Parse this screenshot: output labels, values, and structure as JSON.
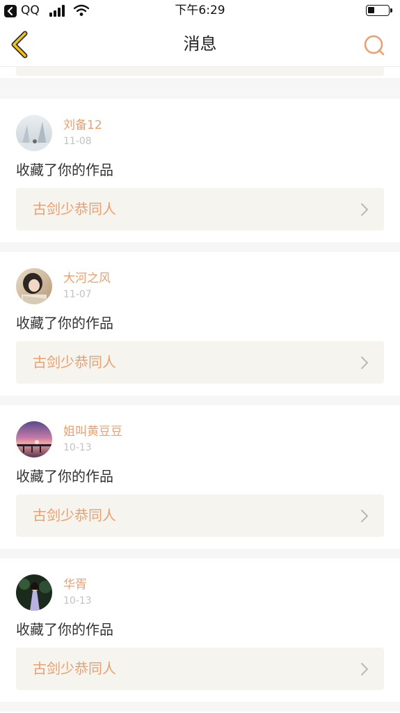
{
  "status_bar": {
    "back_app": "QQ",
    "time": "下午6:29",
    "battery_level": 0.35
  },
  "nav": {
    "title": "消息",
    "back_icon": "chevron-left-icon",
    "search_icon": "search-icon"
  },
  "colors": {
    "accent": "#ec9f6e",
    "back_arrow": "#e6b800",
    "work_box_bg": "#f5f4ee",
    "date": "#c2c2c2",
    "text": "#333333",
    "separator": "#f6f6f6"
  },
  "partial_card": {
    "note": ""
  },
  "messages": [
    {
      "username": "刘备12",
      "date": "11-08",
      "action": "收藏了你的作品",
      "work_title": "古剑少恭同人"
    },
    {
      "username": "大河之风",
      "date": "11-07",
      "action": "收藏了你的作品",
      "work_title": "古剑少恭同人"
    },
    {
      "username": "姐叫黄豆豆",
      "date": "10-13",
      "action": "收藏了你的作品",
      "work_title": "古剑少恭同人"
    },
    {
      "username": "华胥",
      "date": "10-13",
      "action": "收藏了你的作品",
      "work_title": "古剑少恭同人"
    }
  ]
}
